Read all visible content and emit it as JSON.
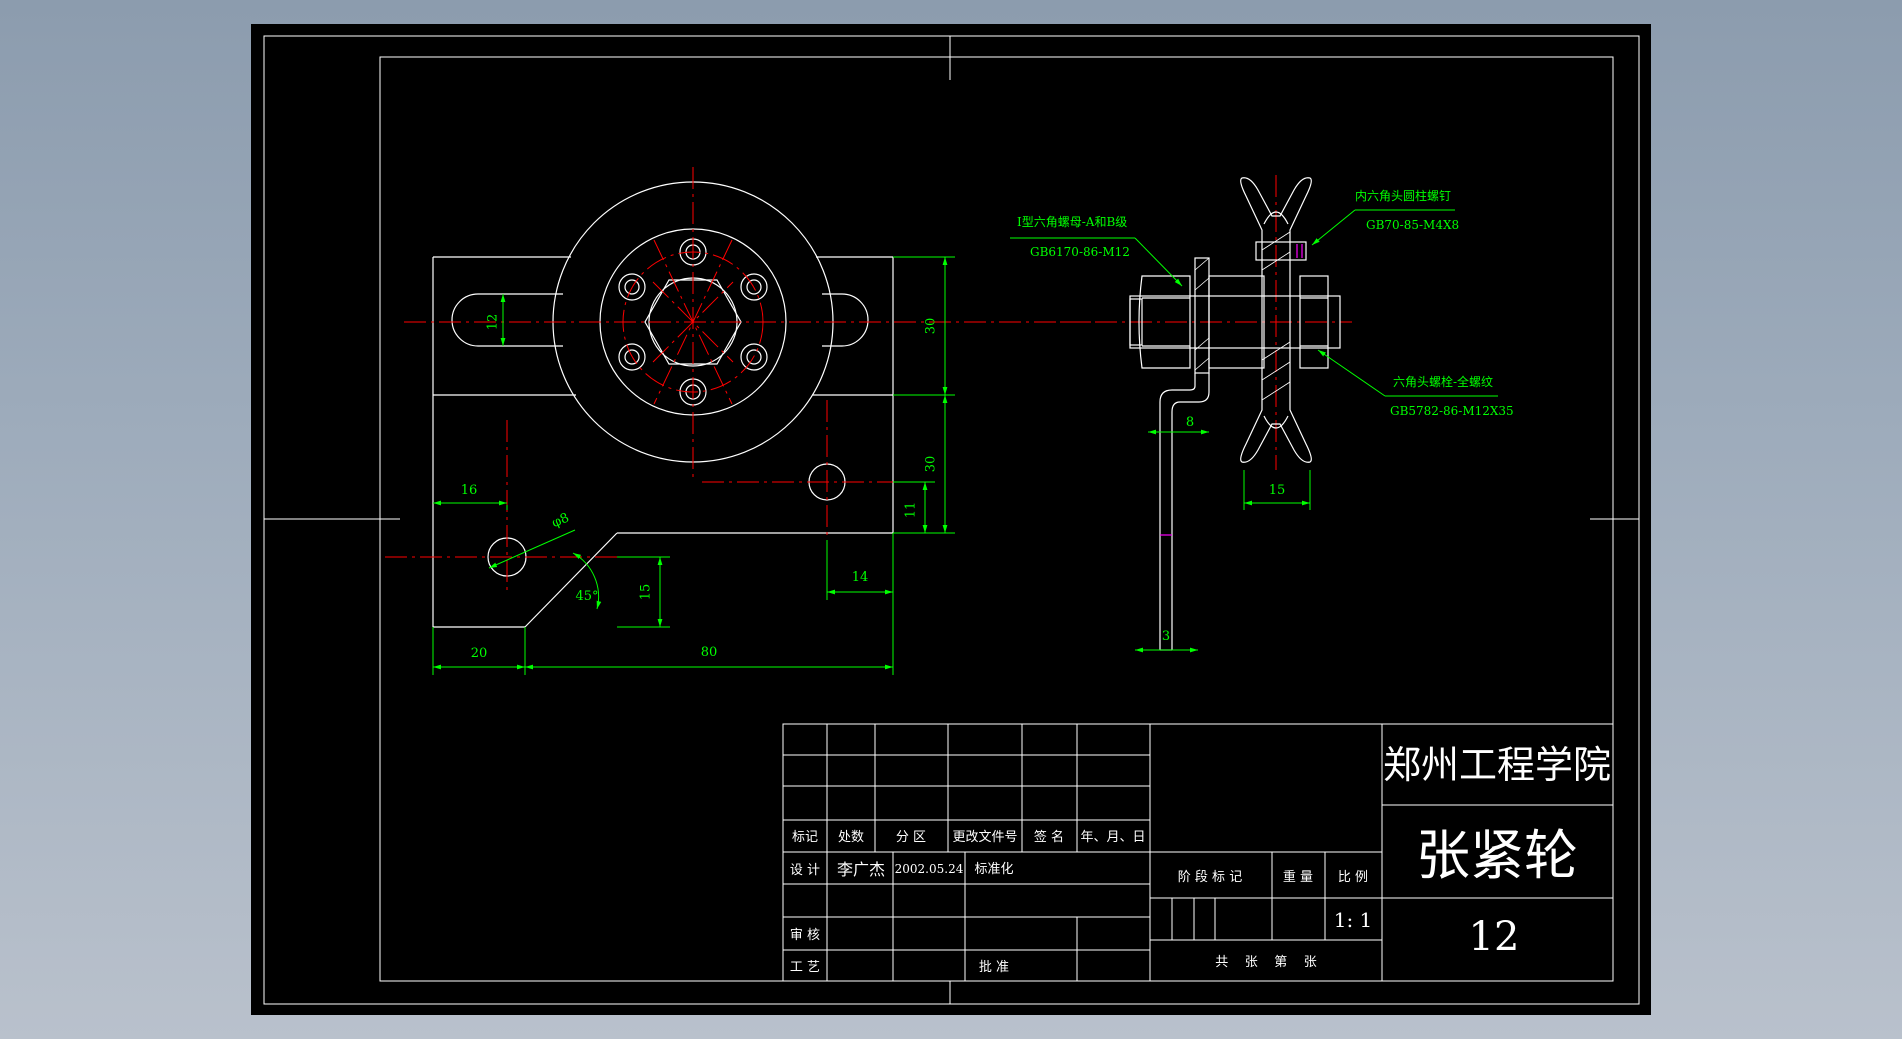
{
  "colors": {
    "background": "#000000",
    "outline": "#ffffff",
    "centerline": "#ff0000",
    "dimension": "#00ff00",
    "accent": "#ff00ff",
    "viewport_bg": "#9aa8b8"
  },
  "dimensions": {
    "d12": "12",
    "d30a": "30",
    "d30b": "30",
    "d11": "11",
    "d16": "16",
    "phi8": "φ8",
    "d45": "45°",
    "d15": "15",
    "d14": "14",
    "d20": "20",
    "d80": "80",
    "d8": "8",
    "d15b": "15",
    "d3": "3"
  },
  "callouts": {
    "nut_name": "I型六角螺母-A和B级",
    "nut_code": "GB6170-86-M12",
    "screw_name": "内六角头圆柱螺钉",
    "screw_code": "GB70-85-M4X8",
    "bolt_name": "六角头螺栓-全螺纹",
    "bolt_code": "GB5782-86-M12X35"
  },
  "title_block": {
    "school": "郑州工程学院",
    "part_name": "张紧轮",
    "drawing_no": "12",
    "header_labels": [
      "标记",
      "处数",
      "分 区",
      "更改文件号",
      "签 名",
      "年、月、日"
    ],
    "design_label": "设 计",
    "designer": "李广杰",
    "date": "2002.05.24",
    "standardization": "标准化",
    "review_label": "审 核",
    "process_label": "工 艺",
    "approve_label": "批 准",
    "stage_label": "阶 段 标 记",
    "weight_label": "重 量",
    "scale_label": "比 例",
    "scale_value": "1: 1",
    "sheets_text": "共    张    第    张"
  }
}
